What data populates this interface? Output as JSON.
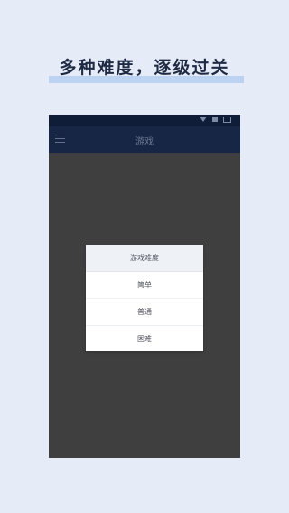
{
  "promo": {
    "title": "多种难度，逐级过关"
  },
  "app": {
    "title": "游戏"
  },
  "dialog": {
    "title": "游戏难度",
    "options": [
      "简单",
      "普通",
      "困难"
    ]
  },
  "colors": {
    "page_background": "#e5ebf7",
    "title_highlight": "#bcd2f1",
    "app_bar": "#172645",
    "status_bar": "#101d39",
    "screen_dim": "#3f3f3f",
    "dialog_header_bg": "#eef1f5"
  },
  "icons": {
    "menu": "hamburger-menu-icon",
    "status": [
      "signal-icon",
      "wifi-icon",
      "battery-icon"
    ]
  }
}
